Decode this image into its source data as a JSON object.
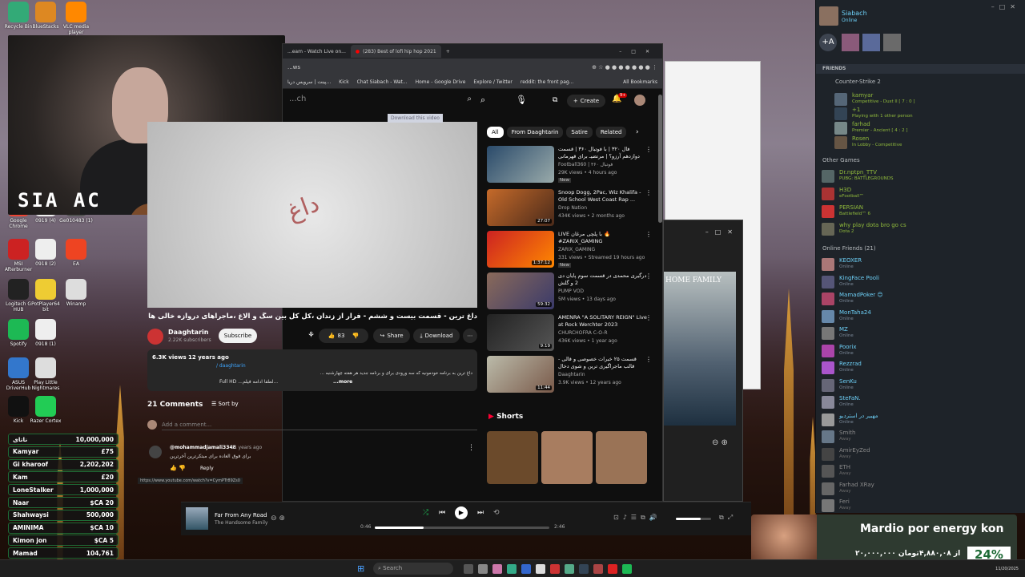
{
  "desktop": {
    "icons": [
      {
        "label": "Recycle Bin"
      },
      {
        "label": "BlueStacks"
      },
      {
        "label": "VLC media player"
      },
      {
        "label": "Google Chrome"
      },
      {
        "label": "0919 (4)"
      },
      {
        "label": "Ge010483 (1)"
      },
      {
        "label": "MSI Afterburner"
      },
      {
        "label": "0918 (2)"
      },
      {
        "label": "EA"
      },
      {
        "label": "Logitech G HUB"
      },
      {
        "label": "PotPlayer64 bit"
      },
      {
        "label": "Winamp"
      },
      {
        "label": "Spotify"
      },
      {
        "label": "0918 (1)"
      },
      {
        "label": "ASUS DriverHub"
      },
      {
        "label": "Play Little Nightmares"
      },
      {
        "label": "Kick"
      },
      {
        "label": "Razer Cortex"
      }
    ]
  },
  "stream_overlay": {
    "logo_text": "SIA AC"
  },
  "browser": {
    "tabs": [
      {
        "label": "...eam - Watch Live on..."
      },
      {
        "label": "(283) Best of lofi hip hop 2021"
      }
    ],
    "address": "...ws",
    "bookmarks": [
      "پینت | سرویس دریا...",
      "Kick",
      "Chat Siabach - Wat...",
      "Home - Google Drive",
      "Explore / Twitter",
      "reddit: the front pag...",
      "All Bookmarks"
    ],
    "search_placeholder": "...ch",
    "create_label": "Create",
    "notif_count": "9+",
    "download_banner": "Download this video",
    "video": {
      "title": "داغ ترین - قسمت بیست و ششم - فرار از زندان ،کل کل بین سگ و الاغ ،ماجراهای دروازه خالی ها و گل نزن ها",
      "channel": "Daaghtarin",
      "subscribers": "2.22K subscribers",
      "subscribe_label": "Subscribe",
      "likes": "83",
      "share_label": "Share",
      "download_label": "Download",
      "views": "6.3K views  12 years ago",
      "hashtag": "/ daaghtarin",
      "desc_line1": "داغ ترین به برنامه خودمونیه که سه ورودی برای و برنامه جدید هر هفته چهارشنبه ...",
      "desc_line2": "Full HD ...لطفا ادامه فیلم...",
      "more_label": "...more"
    },
    "chips": [
      "All",
      "From Daaghtarin",
      "Satire",
      "Related"
    ],
    "recommendations": [
      {
        "title": "فال ۳۲۰ | با فوتبال ۳۶۰ | قسمت دوازدهم آرزو؟ | مرتضیـ برای قهرمانی",
        "channel": "Football360 | فوتبال ۳۶۰",
        "meta": "29K views • 4 hours ago",
        "badge": "New",
        "duration": ""
      },
      {
        "title": "Snoop Dogg, 2Pac, Wiz Khalifa - Old School West Coast Rap ...",
        "channel": "Drop Nation",
        "meta": "434K views • 2 months ago",
        "badge": "",
        "duration": "27:07"
      },
      {
        "title": "LIVE با پلچی مرغان 🔥 #ZARIX_GAMING",
        "channel": "ZARIX_GAMING",
        "meta": "331 views • Streamed 19 hours ago",
        "badge": "New",
        "duration": "1:37:12"
      },
      {
        "title": "درگیری محمدی در قسمت سوم پایان دی 2 و گلش",
        "channel": "PUMP VOD",
        "meta": "5M views • 13 days ago",
        "badge": "",
        "duration": "59:32"
      },
      {
        "title": "AMENRA \"A SOLITARY REIGN\" Live at Rock Werchter 2023",
        "channel": "CHURCHOFRA C-O-R",
        "meta": "436K views • 1 year ago",
        "badge": "",
        "duration": "9:19"
      },
      {
        "title": "قسمت ۲۵ خبرات خصوصی و قالی - قالب ماجراگیری ترین و شوی دخال بازگشتی به",
        "channel": "Daaghtarin",
        "meta": "3.9K views • 12 years ago",
        "badge": "",
        "duration": "11:44"
      }
    ],
    "shorts_label": "Shorts",
    "comments": {
      "count_label": "21 Comments",
      "sort_label": "Sort by",
      "add_placeholder": "Add a comment...",
      "author": "@mohammadjamali3348",
      "age": "11 years ago",
      "text": "برای فوق العاده برای مبتکرترین آخرترین",
      "reply_label": "Reply"
    },
    "status_url": "https://www.youtube.com/watch?v=CymPTr89Zs0"
  },
  "steam": {
    "user": "Siabach",
    "user_status": "Online",
    "friends_header": "FRIENDS",
    "group_cs": "Counter-Strike 2",
    "cs_friends": [
      {
        "name": "kamyar",
        "status": "Competitive - Dust II [ 7 : 0 ]"
      },
      {
        "name": "+1",
        "status": "Playing with 1 other person"
      },
      {
        "name": "farhad",
        "status": "Premier - Ancient [ 4 : 2 ]"
      },
      {
        "name": "Rosen",
        "status": "In Lobby - Competitive"
      }
    ],
    "group_other": "Other Games",
    "other_friends": [
      {
        "name": "Dr.nptpn_TTV",
        "status": "PUBG: BATTLEGROUNDS"
      },
      {
        "name": "H3D",
        "status": "eFootball™"
      },
      {
        "name": "PERSIAN",
        "status": "Battlefield™ 6"
      },
      {
        "name": "why play dota bro go cs",
        "status": "Dota 2"
      }
    ],
    "group_online": "Online Friends (21)",
    "online_friends": [
      {
        "name": "KEOXER",
        "status": "Online"
      },
      {
        "name": "KingFace Pooli",
        "status": "Online"
      },
      {
        "name": "MamadPoker 😊",
        "status": "Online"
      },
      {
        "name": "MonTaha24",
        "status": "Online"
      },
      {
        "name": "MZ",
        "status": "Online"
      },
      {
        "name": "Poorix",
        "status": "Online"
      },
      {
        "name": "Rezzrad",
        "status": "Online"
      },
      {
        "name": "SenKu",
        "status": "Online"
      },
      {
        "name": "SteFaN.",
        "status": "Online"
      },
      {
        "name": "مهبیر در استردیو",
        "status": "Online"
      },
      {
        "name": "Smith",
        "status": "Away"
      },
      {
        "name": "AmirEyZed",
        "status": "Away"
      },
      {
        "name": "ETH",
        "status": "Away"
      },
      {
        "name": "Farhad XRay",
        "status": "Away"
      },
      {
        "name": "Feri",
        "status": "Away"
      }
    ]
  },
  "small_window": {
    "banner_text": "HOME FAMILY"
  },
  "player": {
    "song": "Far From Any Road",
    "artist": "The Handsome Family",
    "elapsed": "0:46",
    "total": "2:46",
    "progress": 0.28,
    "volume": 0.7
  },
  "leaderboard": [
    {
      "name": "ناتای",
      "amount": "10,000,000"
    },
    {
      "name": "Kamyar",
      "amount": "£75"
    },
    {
      "name": "Gi kharoof",
      "amount": "2,202,202"
    },
    {
      "name": "Kam",
      "amount": "£20"
    },
    {
      "name": "LoneStalker",
      "amount": "1,000,000"
    },
    {
      "name": "Naar",
      "amount": "$CA 20"
    },
    {
      "name": "Shahwaysi",
      "amount": "500,000"
    },
    {
      "name": "AMINIMA",
      "amount": "$CA 10"
    },
    {
      "name": "Kimon jon",
      "amount": "$CA 5"
    },
    {
      "name": "Mamad",
      "amount": "104,761"
    }
  ],
  "donation": {
    "title": "Mardio por energy kon",
    "goal_text": "۲۰,۰۰۰,۰۰۰ تومان",
    "current_text": "از ۴,۸۸۰,۰۸",
    "percent": "24%"
  },
  "taskbar": {
    "search_placeholder": "Search",
    "date": "11/20/2025"
  },
  "colors": {
    "accent_green": "#1e6a36",
    "steam_bg": "#1e2329",
    "yt_bg": "#0f0f0f"
  }
}
